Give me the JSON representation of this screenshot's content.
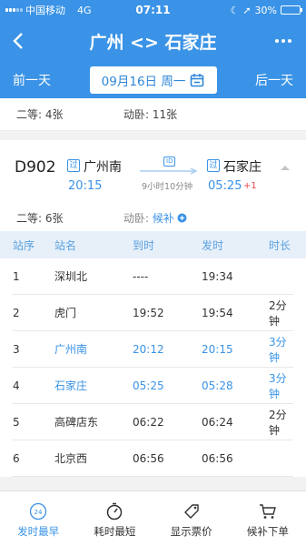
{
  "status": {
    "carrier": "中国移动",
    "network": "4G",
    "time": "07:11",
    "battery": "30%",
    "battery_level": 0.3
  },
  "header": {
    "title": "广州 <> 石家庄"
  },
  "datebar": {
    "prev": "前一天",
    "date": "09月16日 周一",
    "next": "后一天"
  },
  "prev_train": {
    "seat1": "二等: 4张",
    "seat2": "动卧: 11张"
  },
  "train": {
    "number": "D902",
    "pass_label": "过",
    "from": "广州南",
    "dep": "20:15",
    "duration": "9小时10分钟",
    "id_badge": "ID",
    "to": "石家庄",
    "arr": "05:25",
    "day_offset": "+1",
    "seat1": "二等: 6张",
    "seat2_label": "动卧:",
    "seat2_value": "候补"
  },
  "table": {
    "headers": [
      "站序",
      "站名",
      "到时",
      "发时",
      "时长"
    ],
    "rows": [
      {
        "seq": "1",
        "name": "深圳北",
        "arr": "----",
        "dep": "19:34",
        "dur": "",
        "highlight": false
      },
      {
        "seq": "2",
        "name": "虎门",
        "arr": "19:52",
        "dep": "19:54",
        "dur": "2分钟",
        "highlight": false
      },
      {
        "seq": "3",
        "name": "广州南",
        "arr": "20:12",
        "dep": "20:15",
        "dur": "3分钟",
        "highlight": true
      },
      {
        "seq": "4",
        "name": "石家庄",
        "arr": "05:25",
        "dep": "05:28",
        "dur": "3分钟",
        "highlight": true
      },
      {
        "seq": "5",
        "name": "高碑店东",
        "arr": "06:22",
        "dep": "06:24",
        "dur": "2分钟",
        "highlight": false
      },
      {
        "seq": "6",
        "name": "北京西",
        "arr": "06:56",
        "dep": "06:56",
        "dur": "",
        "highlight": false
      }
    ]
  },
  "tabs": [
    {
      "label": "发时最早",
      "icon": "clock-24-icon",
      "active": true,
      "badge": "24"
    },
    {
      "label": "耗时最短",
      "icon": "stopwatch-icon",
      "active": false
    },
    {
      "label": "显示票价",
      "icon": "price-tag-icon",
      "active": false
    },
    {
      "label": "候补下单",
      "icon": "cart-icon",
      "active": false
    }
  ],
  "colors": {
    "primary": "#3a93e6",
    "accent_red": "#e5484d"
  }
}
